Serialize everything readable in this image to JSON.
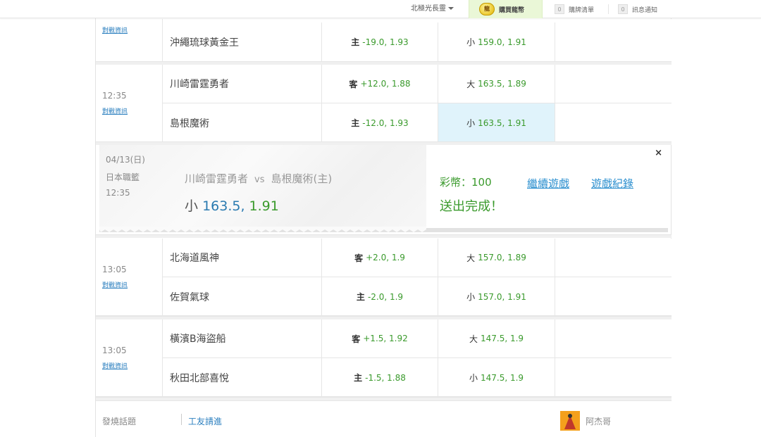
{
  "topbar": {
    "user_label": "北極光長靈",
    "buy_coin_icon": "龍",
    "buy_label": "購買龍幣",
    "cart_count": "0",
    "cart_label": "購牌清單",
    "notice_count": "0",
    "notice_label": "訊息通知"
  },
  "matches": [
    {
      "time": "",
      "info_label": "對戰資訊",
      "rows": [
        {
          "team": "沖繩琉球黃金王",
          "handicap_key": "主",
          "handicap_val": "-19.0, 1.93",
          "total_key": "小",
          "total_val": "159.0, 1.91"
        }
      ]
    },
    {
      "time": "12:35",
      "info_label": "對戰資訊",
      "rows": [
        {
          "team": "川崎雷霆勇者",
          "handicap_key": "客",
          "handicap_val": "+12.0, 1.88",
          "total_key": "大",
          "total_val": "163.5, 1.89"
        },
        {
          "team": "島根魔術",
          "handicap_key": "主",
          "handicap_val": "-12.0, 1.93",
          "total_key": "小",
          "total_val": "163.5, 1.91"
        }
      ]
    },
    {
      "time": "13:05",
      "info_label": "對戰資訊",
      "rows": [
        {
          "team": "北海道風神",
          "handicap_key": "客",
          "handicap_val": "+2.0, 1.9",
          "total_key": "大",
          "total_val": "157.0, 1.89"
        },
        {
          "team": "佐賀氣球",
          "handicap_key": "主",
          "handicap_val": "-2.0, 1.9",
          "total_key": "小",
          "total_val": "157.0, 1.91"
        }
      ]
    },
    {
      "time": "13:05",
      "info_label": "對戰資訊",
      "rows": [
        {
          "team": "橫濱B海盜船",
          "handicap_key": "客",
          "handicap_val": "+1.5, 1.92",
          "total_key": "大",
          "total_val": "147.5, 1.9"
        },
        {
          "team": "秋田北部喜悅",
          "handicap_key": "主",
          "handicap_val": "-1.5, 1.88",
          "total_key": "小",
          "total_val": "147.5, 1.9"
        }
      ]
    }
  ],
  "bet_panel": {
    "date": "04/13(日)",
    "league": "日本職籃",
    "time": "12:35",
    "team_a": "川崎雷霆勇者",
    "vs": "vs",
    "team_b": "島根魔術(主)",
    "pick_key": "小",
    "pick_value": "163.5,",
    "pick_odds": "1.91",
    "coin_text": "彩幣：100",
    "done_text": "送出完成！",
    "continue_label": "繼續遊戲",
    "history_label": "遊戲紀錄",
    "close_label": "×"
  },
  "footer": {
    "topic_label": "發燒話題",
    "recruit_label": "工友請進",
    "user_name": "阿杰哥"
  },
  "colors": {
    "odds_green": "#3a9a2c",
    "link_blue": "#2b8fcf",
    "selected_cell": "#e0f3fb",
    "buy_bg": "#eaf7d7"
  }
}
